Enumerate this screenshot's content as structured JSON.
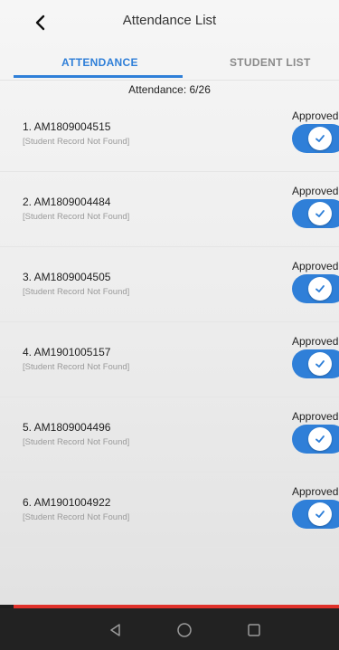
{
  "header": {
    "title": "Attendance List"
  },
  "tabs": [
    {
      "label": "ATTENDANCE",
      "active": true
    },
    {
      "label": "STUDENT LIST",
      "active": false
    }
  ],
  "summary": "Attendance: 6/26",
  "students": [
    {
      "id": "1. AM1809004515",
      "note": "[Student Record Not Found]",
      "status": "Approved",
      "approved": true
    },
    {
      "id": "2. AM1809004484",
      "note": "[Student Record Not Found]",
      "status": "Approved",
      "approved": true
    },
    {
      "id": "3. AM1809004505",
      "note": "[Student Record Not Found]",
      "status": "Approved",
      "approved": true
    },
    {
      "id": "4. AM1901005157",
      "note": "[Student Record Not Found]",
      "status": "Approved",
      "approved": true
    },
    {
      "id": "5. AM1809004496",
      "note": "[Student Record Not Found]",
      "status": "Approved",
      "approved": true
    },
    {
      "id": "6. AM1901004922",
      "note": "[Student Record Not Found]",
      "status": "Approved",
      "approved": true
    }
  ],
  "colors": {
    "accent": "#2f7fd8",
    "alert": "#e0312a"
  },
  "icons": {
    "back": "back-arrow-icon",
    "check": "checkmark-icon",
    "nav_back": "nav-back-icon",
    "nav_home": "nav-home-icon",
    "nav_recents": "nav-recents-icon"
  }
}
